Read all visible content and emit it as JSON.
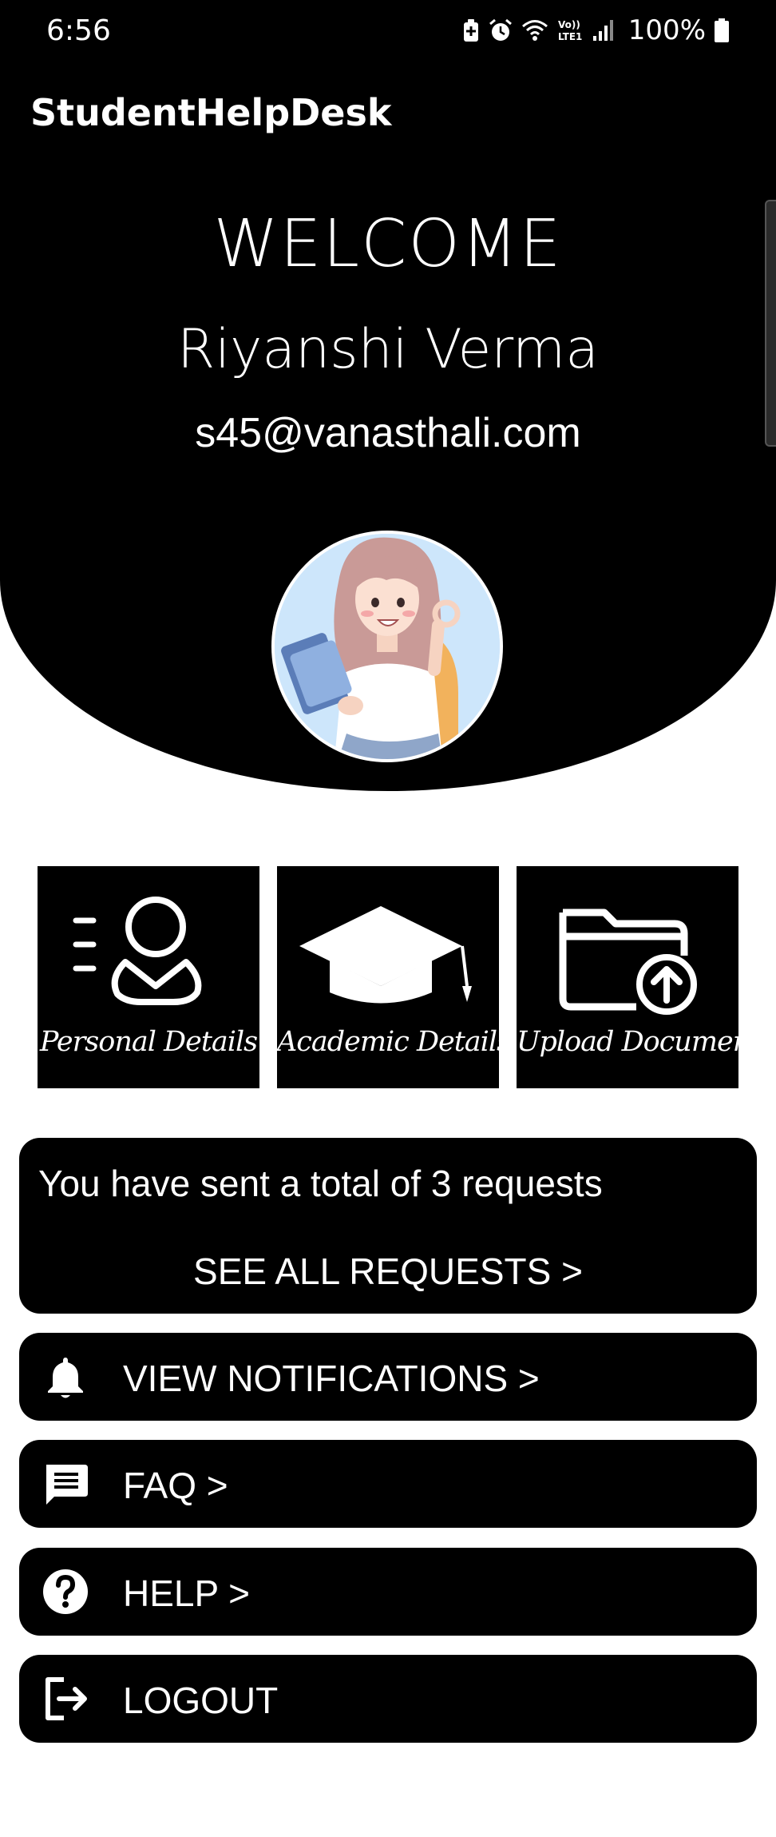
{
  "status_bar": {
    "time": "6:56",
    "battery": "100%",
    "icons": [
      "battery-saver-icon",
      "alarm-icon",
      "wifi-icon",
      "volte-icon",
      "signal-icon",
      "battery-icon"
    ]
  },
  "app": {
    "title": "StudentHelpDesk"
  },
  "profile": {
    "welcome": "WELCOME",
    "name": "Riyanshi Verma",
    "email": "s45@vanasthali.com"
  },
  "tiles": [
    {
      "label": "Personal Details",
      "icon": "person-icon"
    },
    {
      "label": "Academic Details",
      "icon": "graduation-cap-icon"
    },
    {
      "label": "Upload Documents",
      "icon": "folder-upload-icon"
    }
  ],
  "requests": {
    "summary": "You have sent a total of 3 requests",
    "see_all": "SEE ALL REQUESTS >"
  },
  "menu": {
    "notifications": "VIEW NOTIFICATIONS >",
    "faq": "FAQ >",
    "help": "HELP >",
    "logout": "LOGOUT"
  },
  "colors": {
    "primary": "#000000",
    "on_primary": "#ffffff",
    "background": "#ffffff",
    "avatar_bg": "#cde6fb"
  }
}
